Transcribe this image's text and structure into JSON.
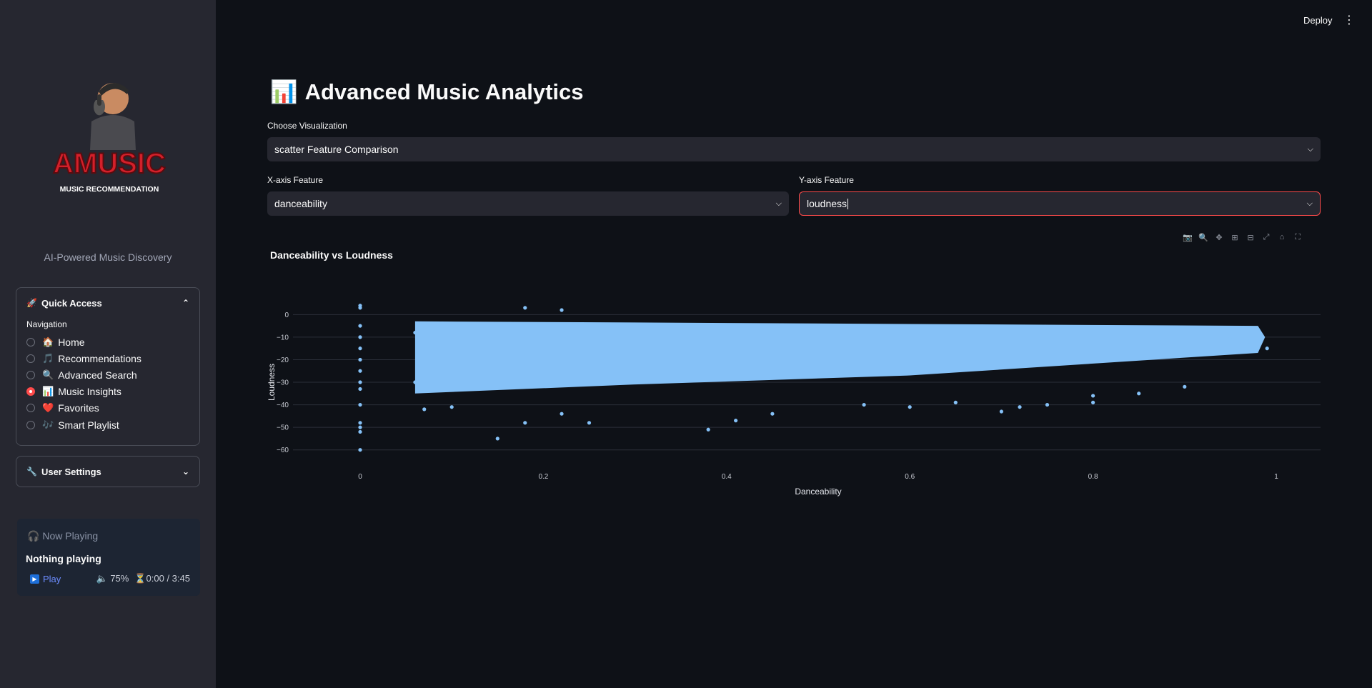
{
  "header": {
    "deploy_label": "Deploy",
    "menu_icon": "⋮"
  },
  "sidebar": {
    "logo_text": "AMUSIC",
    "logo_subtext": "MUSIC RECOMMENDATION",
    "tagline": "AI-Powered Music Discovery",
    "quick_access": {
      "title": "Quick Access",
      "nav_label": "Navigation",
      "items": [
        {
          "emoji": "🏠",
          "label": "Home",
          "selected": false
        },
        {
          "emoji": "🎵",
          "label": "Recommendations",
          "selected": false
        },
        {
          "emoji": "🔍",
          "label": "Advanced Search",
          "selected": false
        },
        {
          "emoji": "📊",
          "label": "Music Insights",
          "selected": true
        },
        {
          "emoji": "❤️",
          "label": "Favorites",
          "selected": false
        },
        {
          "emoji": "🎶",
          "label": "Smart Playlist",
          "selected": false
        }
      ]
    },
    "user_settings": {
      "title": "User Settings"
    },
    "now_playing": {
      "title": "Now Playing",
      "track": "Nothing playing",
      "play_label": "Play",
      "volume": "75%",
      "time": "0:00 / 3:45"
    }
  },
  "main": {
    "title": "Advanced Music Analytics",
    "title_emoji": "📊",
    "viz_label": "Choose Visualization",
    "viz_value": "scatter Feature Comparison",
    "x_label": "X-axis Feature",
    "x_value": "danceability",
    "y_label": "Y-axis Feature",
    "y_value": "loudness"
  },
  "chart_data": {
    "type": "scatter",
    "title": "Danceability vs Loudness",
    "xlabel": "Danceability",
    "ylabel": "Loudness",
    "xlim": [
      -0.15,
      1.0
    ],
    "ylim": [
      -62,
      2
    ],
    "xticks": [
      "0",
      "0.2",
      "0.4",
      "0.6",
      "0.8",
      "1"
    ],
    "xtick_values": [
      0,
      0.2,
      0.4,
      0.6,
      0.8,
      1.0
    ],
    "yticks": [
      "0",
      "−10",
      "−20",
      "−30",
      "−40",
      "−50",
      "−60"
    ],
    "ytick_values": [
      0,
      -10,
      -20,
      -30,
      -40,
      -50,
      -60
    ],
    "marker_color": "#85c1f7",
    "grid": "horizontal",
    "series": [
      {
        "points": [
          [
            0.0,
            4
          ],
          [
            0.0,
            3
          ],
          [
            0.0,
            -5
          ],
          [
            0.0,
            -10
          ],
          [
            0.0,
            -15
          ],
          [
            0.0,
            -20
          ],
          [
            0.0,
            -25
          ],
          [
            0.0,
            -30
          ],
          [
            0.0,
            -33
          ],
          [
            0.0,
            -40
          ],
          [
            0.0,
            -48
          ],
          [
            0.0,
            -50
          ],
          [
            0.0,
            -52
          ],
          [
            0.0,
            -60
          ],
          [
            0.06,
            -8
          ],
          [
            0.06,
            -30
          ],
          [
            0.07,
            -42
          ],
          [
            0.1,
            -41
          ],
          [
            0.15,
            -55
          ],
          [
            0.18,
            -48
          ],
          [
            0.18,
            3
          ],
          [
            0.22,
            2
          ],
          [
            0.22,
            -44
          ],
          [
            0.25,
            -48
          ],
          [
            0.38,
            -51
          ],
          [
            0.41,
            -47
          ],
          [
            0.45,
            -44
          ],
          [
            0.55,
            -40
          ],
          [
            0.6,
            -41
          ],
          [
            0.65,
            -39
          ],
          [
            0.7,
            -43
          ],
          [
            0.72,
            -41
          ],
          [
            0.75,
            -40
          ],
          [
            0.8,
            -39
          ],
          [
            0.8,
            -36
          ],
          [
            0.85,
            -35
          ],
          [
            0.9,
            -32
          ],
          [
            0.95,
            -10
          ],
          [
            0.97,
            -12
          ],
          [
            0.99,
            -15
          ]
        ]
      }
    ],
    "density_band": {
      "x_start": 0.06,
      "x_end": 0.98,
      "y_top": -1,
      "y_bottom_left": -35,
      "y_bottom_right": -17
    }
  }
}
